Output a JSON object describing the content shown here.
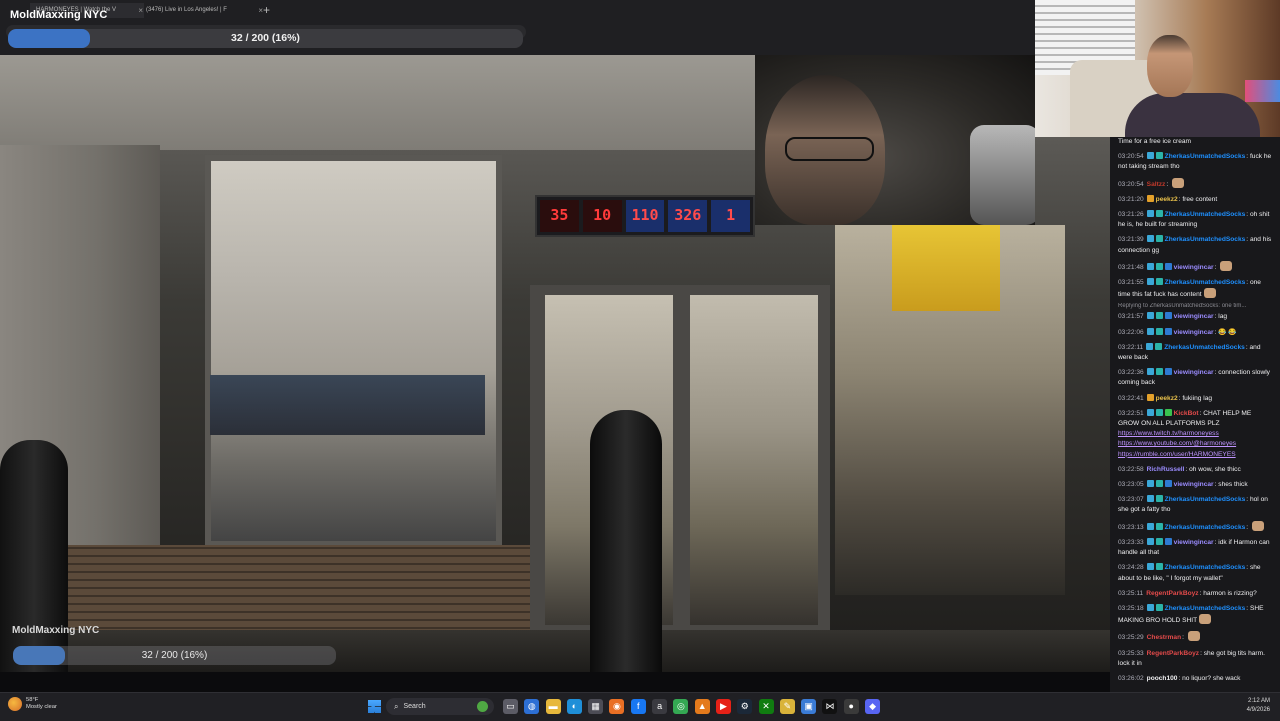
{
  "browser": {
    "tabs": [
      {
        "label": "HARMONEYES | Watch the V",
        "close": "×",
        "active": true
      },
      {
        "label": "(3476) Live in Los Angeles! | F",
        "close": "×",
        "active": false
      }
    ],
    "new_tab": "+"
  },
  "overlay": {
    "stream_title": "MoldMaxxing NYC",
    "goal_text": "32 / 200 (16%)",
    "goal_fraction": 0.16,
    "bottom_title": "MoldMaxxing NYC",
    "bottom_goal_text": "32 / 200 (16%)"
  },
  "video": {
    "price_sign": [
      {
        "value": "35",
        "color": "red"
      },
      {
        "value": "10",
        "color": "red"
      },
      {
        "value": "110",
        "color": "blue"
      },
      {
        "value": "326",
        "color": "blue"
      },
      {
        "value": "1",
        "color": "blue"
      }
    ]
  },
  "chat": {
    "messages": [
      {
        "time": "",
        "user": "",
        "user_color": "#efeff1",
        "text": "Time for a free ice cream",
        "badges": [],
        "emote": false
      },
      {
        "time": "03:20:54",
        "user": "ZherkasUnmatchedSocks",
        "user_color": "#1e90ff",
        "text": "fuck he not taking stream tho",
        "badges": [
          "#3ba8d8",
          "#2bb3a8"
        ],
        "emote": false
      },
      {
        "time": "03:20:54",
        "user": "Saltzz",
        "user_color": "#c0392b",
        "text": "",
        "badges": [],
        "emote": true
      },
      {
        "time": "03:21:20",
        "user": "peekz2",
        "user_color": "#e8c04a",
        "text": "free content",
        "badges": [
          "#e3a02a"
        ],
        "emote": false
      },
      {
        "time": "03:21:26",
        "user": "ZherkasUnmatchedSocks",
        "user_color": "#1e90ff",
        "text": "oh shit he is, he built for streaming",
        "badges": [
          "#3ba8d8",
          "#2bb3a8"
        ],
        "emote": false
      },
      {
        "time": "03:21:39",
        "user": "ZherkasUnmatchedSocks",
        "user_color": "#1e90ff",
        "text": "and his connection gg",
        "badges": [
          "#3ba8d8",
          "#2bb3a8"
        ],
        "emote": false
      },
      {
        "time": "03:21:48",
        "user": "viewingincar",
        "user_color": "#9b8cff",
        "text": "",
        "badges": [
          "#3ba8d8",
          "#2bb3a8",
          "#2e7ad1"
        ],
        "emote": true
      },
      {
        "time": "03:21:55",
        "user": "ZherkasUnmatchedSocks",
        "user_color": "#1e90ff",
        "text": "one time this fat fuck has content",
        "badges": [
          "#3ba8d8",
          "#2bb3a8"
        ],
        "emote": true
      },
      {
        "time": "03:21:57",
        "user": "viewingincar",
        "user_color": "#9b8cff",
        "text": "lag",
        "badges": [
          "#3ba8d8",
          "#2bb3a8",
          "#2e7ad1"
        ],
        "emote": false,
        "reply_note": "Replying to ZherkasUnmatchedSocks: one tim..."
      },
      {
        "time": "03:22:06",
        "user": "viewingincar",
        "user_color": "#9b8cff",
        "text": "😂 😂",
        "badges": [
          "#3ba8d8",
          "#2bb3a8",
          "#2e7ad1"
        ],
        "emote": false
      },
      {
        "time": "03:22:11",
        "user": "ZherkasUnmatchedSocks",
        "user_color": "#1e90ff",
        "text": "and were back",
        "badges": [
          "#3ba8d8",
          "#2bb3a8"
        ],
        "emote": false
      },
      {
        "time": "03:22:36",
        "user": "viewingincar",
        "user_color": "#9b8cff",
        "text": "connection slowly coming back",
        "badges": [
          "#3ba8d8",
          "#2bb3a8",
          "#2e7ad1"
        ],
        "emote": false
      },
      {
        "time": "03:22:41",
        "user": "peekz2",
        "user_color": "#e8c04a",
        "text": "fukiing lag",
        "badges": [
          "#e3a02a"
        ],
        "emote": false
      },
      {
        "time": "03:22:51",
        "user": "KickBot",
        "user_color": "#e24a4a",
        "text": "CHAT HELP ME GROW ON ALL PLATFORMS PLZ",
        "badges": [
          "#3ba8d8",
          "#2bb3a8",
          "#39c24f"
        ],
        "emote": false,
        "links": [
          "https://www.twitch.tv/harmoneyess",
          "https://www.youtube.com/@harmoneyes",
          "https://rumble.com/user/HARMONEYES"
        ]
      },
      {
        "time": "03:22:58",
        "user": "RichRussell",
        "user_color": "#9b8cff",
        "text": "oh wow, she thicc",
        "badges": [],
        "emote": false
      },
      {
        "time": "03:23:05",
        "user": "viewingincar",
        "user_color": "#9b8cff",
        "text": "shes thick",
        "badges": [
          "#3ba8d8",
          "#2bb3a8",
          "#2e7ad1"
        ],
        "emote": false
      },
      {
        "time": "03:23:07",
        "user": "ZherkasUnmatchedSocks",
        "user_color": "#1e90ff",
        "text": "hol on she got a fatty tho",
        "badges": [
          "#3ba8d8",
          "#2bb3a8"
        ],
        "emote": false
      },
      {
        "time": "03:23:13",
        "user": "ZherkasUnmatchedSocks",
        "user_color": "#1e90ff",
        "text": "",
        "badges": [
          "#3ba8d8",
          "#2bb3a8"
        ],
        "emote": true
      },
      {
        "time": "03:23:33",
        "user": "viewingincar",
        "user_color": "#9b8cff",
        "text": "idk if Harmon can handle all that",
        "badges": [
          "#3ba8d8",
          "#2bb3a8",
          "#2e7ad1"
        ],
        "emote": false
      },
      {
        "time": "03:24:28",
        "user": "ZherkasUnmatchedSocks",
        "user_color": "#1e90ff",
        "text": "she about to be like, \" I forgot my wallet\"",
        "badges": [
          "#3ba8d8",
          "#2bb3a8"
        ],
        "emote": false
      },
      {
        "time": "03:25:11",
        "user": "RegentParkBoyz",
        "user_color": "#e24a4a",
        "text": "harmon is rizzing?",
        "badges": [],
        "emote": false
      },
      {
        "time": "03:25:18",
        "user": "ZherkasUnmatchedSocks",
        "user_color": "#1e90ff",
        "text": "SHE MAKING BRO HOLD SHIT",
        "badges": [
          "#3ba8d8",
          "#2bb3a8"
        ],
        "emote": true
      },
      {
        "time": "03:25:29",
        "user": "Chestrman",
        "user_color": "#e24a4a",
        "text": "",
        "badges": [],
        "emote": true
      },
      {
        "time": "03:25:33",
        "user": "RegentParkBoyz",
        "user_color": "#e24a4a",
        "text": "she got big tits harm. lock it in",
        "badges": [],
        "emote": false
      },
      {
        "time": "03:26:02",
        "user": "pooch100",
        "user_color": "#efeff1",
        "text": "no liquor? she wack",
        "badges": [],
        "emote": false
      }
    ]
  },
  "taskbar": {
    "weather_temp": "58°F",
    "weather_desc": "Mostly clear",
    "search_label": "Search",
    "apps": [
      {
        "icon": "task-view-icon",
        "glyph": "▭",
        "color": "#5c5c66"
      },
      {
        "icon": "copilot-icon",
        "glyph": "◍",
        "color": "#2d6fd4"
      },
      {
        "icon": "file-explorer-icon",
        "glyph": "▬",
        "color": "#e7b83c"
      },
      {
        "icon": "edge-icon",
        "glyph": "◐",
        "color": "#1f8fd8"
      },
      {
        "icon": "calculator-icon",
        "glyph": "▦",
        "color": "#4c4c55"
      },
      {
        "icon": "firefox-icon",
        "glyph": "◉",
        "color": "#e96f24"
      },
      {
        "icon": "facebook-icon",
        "glyph": "f",
        "color": "#1877f2"
      },
      {
        "icon": "amazon-icon",
        "glyph": "a",
        "color": "#3a3a40"
      },
      {
        "icon": "chrome-icon",
        "glyph": "◎",
        "color": "#34a853"
      },
      {
        "icon": "vlc-icon",
        "glyph": "▲",
        "color": "#e47a1c"
      },
      {
        "icon": "youtube-icon",
        "glyph": "▶",
        "color": "#e62117"
      },
      {
        "icon": "steam-icon",
        "glyph": "⚙",
        "color": "#1b2838"
      },
      {
        "icon": "xbox-icon",
        "glyph": "✕",
        "color": "#107c10"
      },
      {
        "icon": "notes-icon",
        "glyph": "✎",
        "color": "#d9b33a"
      },
      {
        "icon": "photos-icon",
        "glyph": "▣",
        "color": "#3a7bd5"
      },
      {
        "icon": "capcut-icon",
        "glyph": "⋈",
        "color": "#111111"
      },
      {
        "icon": "obs-icon",
        "glyph": "●",
        "color": "#3a3a3a"
      },
      {
        "icon": "discord-icon",
        "glyph": "◆",
        "color": "#5865f2"
      }
    ],
    "time": "2:12 AM",
    "date": "4/9/2026"
  }
}
